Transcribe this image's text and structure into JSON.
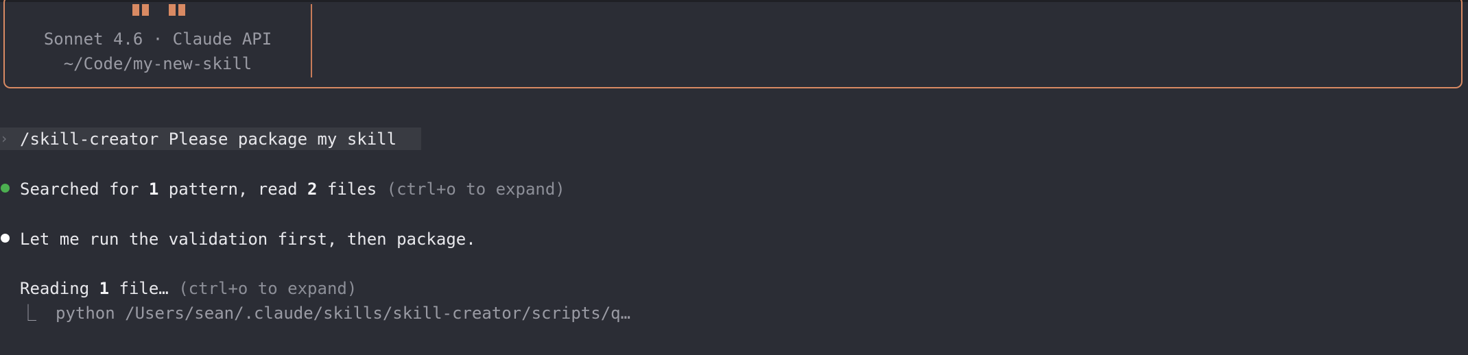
{
  "header": {
    "model_line": "Sonnet 4.6 · Claude API",
    "path_line": "~/Code/my-new-skill"
  },
  "prompt": {
    "chevron": "›",
    "text": "/skill-creator Please package my skill"
  },
  "messages": [
    {
      "status_color": "#4caf50",
      "pre": "Searched for ",
      "count1": "1",
      "mid": " pattern, read ",
      "count2": "2",
      "post": " files",
      "hint": " (ctrl+o to expand)"
    },
    {
      "status_color": "#ffffff",
      "text": "Let me run the validation first, then package."
    }
  ],
  "tool": {
    "pre": "Reading ",
    "count": "1",
    "post": " file…",
    "hint": " (ctrl+o to expand)",
    "branch_glyph": "⎿",
    "command": "python /Users/sean/.claude/skills/skill-creator/scripts/q…"
  }
}
